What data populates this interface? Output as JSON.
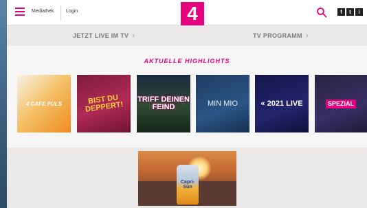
{
  "header": {
    "nav": [
      "Mediathek",
      "Login"
    ],
    "logo_text": "4",
    "social": [
      "f",
      "t",
      "i"
    ]
  },
  "subnav": {
    "live_label": "JETZT LIVE IM TV",
    "program_label": "TV PROGRAMM"
  },
  "highlights": {
    "title": "AKTUELLE HIGHLIGHTS",
    "tiles": [
      {
        "label": "4 CAFE PULS"
      },
      {
        "label": "BIST DU DEPPERT!"
      },
      {
        "label": "TRIFF DEINEN FEIND"
      },
      {
        "label": "MIN MIO"
      },
      {
        "label": "« 2021 LIVE"
      },
      {
        "label": "SPEZIAL"
      }
    ]
  },
  "ad": {
    "brand": "Capri-Sun"
  },
  "colors": {
    "accent": "#e6007e",
    "background": "#ebe8e8"
  }
}
